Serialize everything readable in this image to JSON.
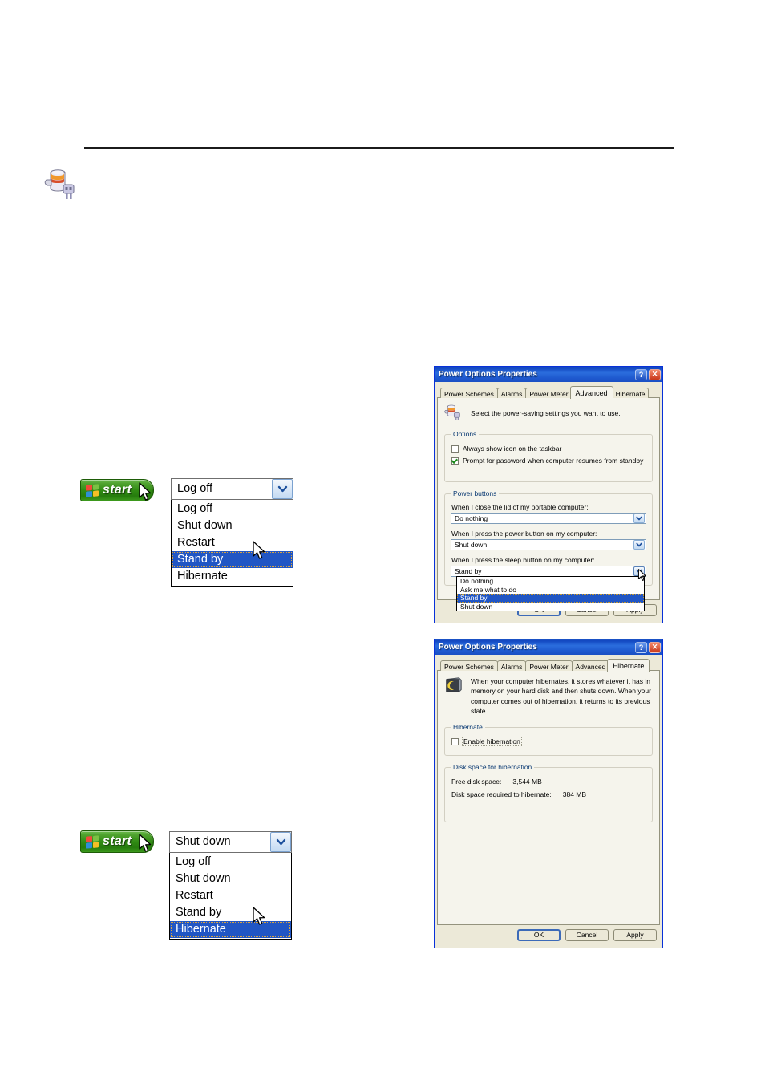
{
  "page": {
    "background": "#ffffff",
    "rule_color": "#1b1b1b",
    "icon": "power-plug-battery-icon"
  },
  "start_menu_examples": [
    {
      "id": "standby",
      "start_button": {
        "label": "start",
        "icon": "windows-flag-icon"
      },
      "combo": {
        "selected_value": "Log off",
        "options": [
          {
            "label": "Log off",
            "selected": false
          },
          {
            "label": "Shut down",
            "selected": false
          },
          {
            "label": "Restart",
            "selected": false
          },
          {
            "label": "Stand by",
            "selected": true
          },
          {
            "label": "Hibernate",
            "selected": false
          }
        ]
      }
    },
    {
      "id": "hibernate",
      "start_button": {
        "label": "start",
        "icon": "windows-flag-icon"
      },
      "combo": {
        "selected_value": "Shut down",
        "options": [
          {
            "label": "Log off",
            "selected": false
          },
          {
            "label": "Shut down",
            "selected": false
          },
          {
            "label": "Restart",
            "selected": false
          },
          {
            "label": "Stand by",
            "selected": false
          },
          {
            "label": "Hibernate",
            "selected": true
          }
        ]
      }
    }
  ],
  "dialog_advanced": {
    "title": "Power Options Properties",
    "titlebar_buttons": {
      "help": "?",
      "close": "✕"
    },
    "tabs": [
      {
        "label": "Power Schemes",
        "active": false
      },
      {
        "label": "Alarms",
        "active": false
      },
      {
        "label": "Power Meter",
        "active": false
      },
      {
        "label": "Advanced",
        "active": true
      },
      {
        "label": "Hibernate",
        "active": false
      }
    ],
    "intro_text": "Select the power-saving settings you want to use.",
    "intro_icon": "power-plug-battery-icon",
    "options_group": {
      "legend": "Options",
      "checkboxes": [
        {
          "label": "Always show icon on the taskbar",
          "checked": false
        },
        {
          "label": "Prompt for password when computer resumes from standby",
          "checked": true
        }
      ]
    },
    "power_buttons_group": {
      "legend": "Power buttons",
      "fields": [
        {
          "label": "When I close the lid of my portable computer:",
          "value": "Do nothing",
          "open": false
        },
        {
          "label": "When I press the power button on my computer:",
          "value": "Shut down",
          "open": false
        },
        {
          "label": "When I press the sleep button on my computer:",
          "value": "Stand by",
          "open": true
        }
      ],
      "open_dropdown_options": [
        {
          "label": "Do nothing",
          "selected": false
        },
        {
          "label": "Ask me what to do",
          "selected": false
        },
        {
          "label": "Stand by",
          "selected": true
        },
        {
          "label": "Shut down",
          "selected": false
        }
      ]
    },
    "buttons": [
      {
        "label": "OK",
        "default": true
      },
      {
        "label": "Cancel",
        "default": false
      },
      {
        "label": "Apply",
        "default": false
      }
    ]
  },
  "dialog_hibernate": {
    "title": "Power Options Properties",
    "titlebar_buttons": {
      "help": "?",
      "close": "✕"
    },
    "tabs": [
      {
        "label": "Power Schemes",
        "active": false
      },
      {
        "label": "Alarms",
        "active": false
      },
      {
        "label": "Power Meter",
        "active": false
      },
      {
        "label": "Advanced",
        "active": false
      },
      {
        "label": "Hibernate",
        "active": true
      }
    ],
    "intro_text": "When your computer hibernates, it stores whatever it has in memory on your hard disk and then shuts down. When your computer comes out of hibernation, it returns to its previous state.",
    "intro_icon": "computer-moon-icon",
    "hibernate_group": {
      "legend": "Hibernate",
      "checkbox": {
        "label": "Enable hibernation",
        "checked": false
      }
    },
    "disk_space_group": {
      "legend": "Disk space for hibernation",
      "rows": [
        {
          "key": "Free disk space:",
          "value": "3,544 MB"
        },
        {
          "key": "Disk space required to hibernate:",
          "value": "384 MB"
        }
      ]
    },
    "buttons": [
      {
        "label": "OK",
        "default": true
      },
      {
        "label": "Cancel",
        "default": false
      },
      {
        "label": "Apply",
        "default": false
      }
    ]
  }
}
